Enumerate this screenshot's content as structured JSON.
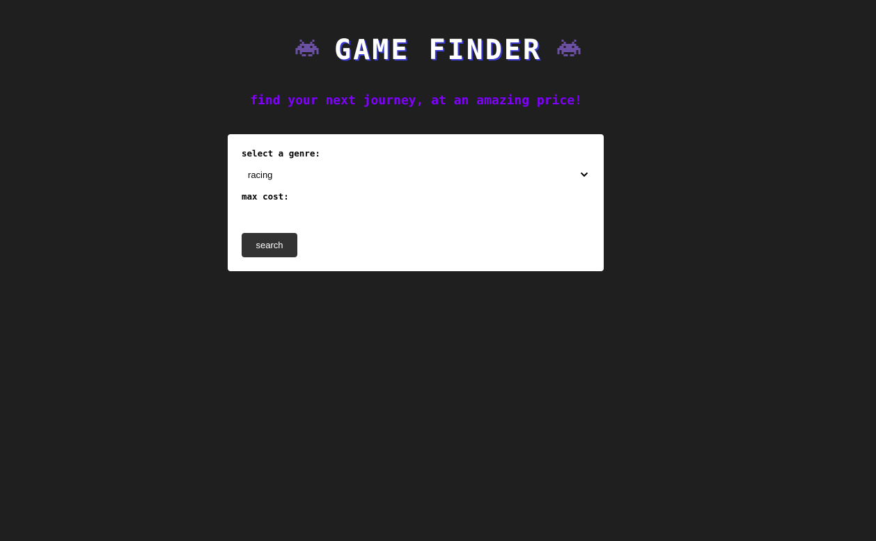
{
  "header": {
    "title": "GAME FINDER",
    "left_icon": "alien-monster-icon",
    "right_icon": "alien-monster-icon",
    "title_color": "#ffffff",
    "icon_color": "#6a4fa3"
  },
  "subtitle": "find your next journey, at an amazing price!",
  "subtitle_color": "#8000ff",
  "form": {
    "genre_label": "select a genre:",
    "genre_selected": "racing",
    "max_cost_label": "max cost:",
    "max_cost_value": "",
    "search_label": "search"
  },
  "colors": {
    "background": "#1f1f1f",
    "card": "#ffffff",
    "button": "#333333"
  }
}
